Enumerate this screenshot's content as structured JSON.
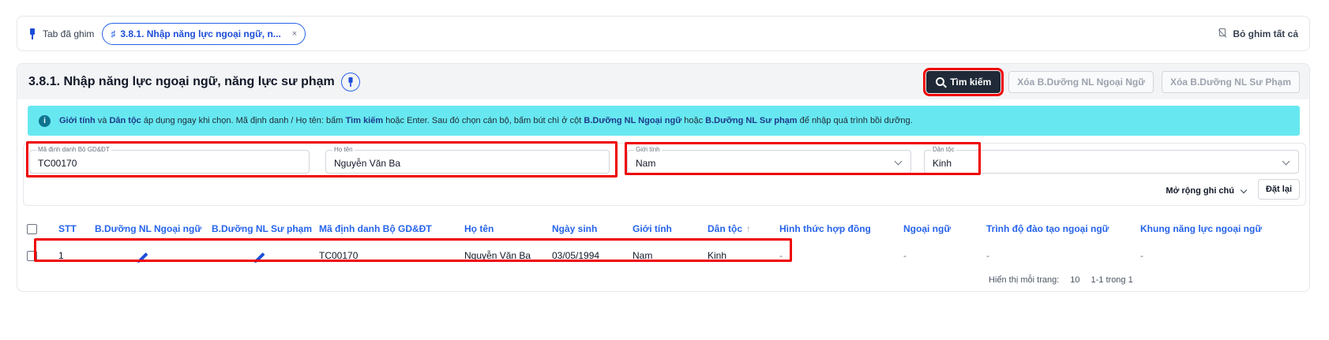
{
  "pin_bar": {
    "label": "Tab đã ghim",
    "pinned_tab": "3.8.1. Nhập năng lực ngoại ngữ, n...",
    "close_glyph": "×",
    "unpin_all": "Bỏ ghim tất cả"
  },
  "page": {
    "title": "3.8.1. Nhập năng lực ngoại ngữ, năng lực sư phạm",
    "actions": {
      "search": "Tìm kiếm",
      "delete_language": "Xóa B.Dưỡng NL Ngoại Ngữ",
      "delete_pedagogy": "Xóa B.Dưỡng NL Sư Phạm"
    }
  },
  "banner": {
    "bold1": "Giới tính",
    "t1": " và ",
    "bold2": "Dân tộc",
    "t2": " áp dụng ngay khi chọn. Mã định danh / Họ tên: bấm ",
    "bold3": "Tìm kiếm",
    "t3": " hoặc Enter. Sau đó chọn cán bộ, bấm bút chì ở cột ",
    "bold4": "B.Dưỡng NL Ngoại ngữ",
    "t4": " hoặc ",
    "bold5": "B.Dưỡng NL Sư phạm",
    "t5": " để nhập quá trình bồi dưỡng."
  },
  "filters": {
    "id": {
      "label": "Mã định danh Bộ GD&ĐT",
      "value": "TC00170"
    },
    "name": {
      "label": "Họ tên",
      "value": "Nguyễn Văn Ba"
    },
    "gender": {
      "label": "Giới tính",
      "value": "Nam"
    },
    "ethnicity": {
      "label": "Dân tộc",
      "value": "Kinh"
    },
    "note_toggle": "Mở rộng ghi chú",
    "reset": "Đặt lại"
  },
  "table": {
    "columns": {
      "stt": "STT",
      "lang_training": "B.Dưỡng NL Ngoại ngữ",
      "ped_training": "B.Dưỡng NL Sư phạm",
      "id": "Mã định danh Bộ GD&ĐT",
      "name": "Họ tên",
      "dob": "Ngày sinh",
      "gender": "Giới tính",
      "ethnicity": "Dân tộc",
      "contract": "Hình thức hợp đồng",
      "language": "Ngoại ngữ",
      "lang_level": "Trình độ đào tạo ngoại ngữ",
      "lang_framework": "Khung năng lực ngoại ngữ"
    },
    "sort_glyph": "↑",
    "rows": [
      {
        "stt": "1",
        "id": "TC00170",
        "name": "Nguyễn Văn Ba",
        "dob": "03/05/1994",
        "gender": "Nam",
        "ethnicity": "Kinh",
        "contract": "-",
        "language": "-",
        "lang_level": "-",
        "lang_framework": "-"
      }
    ]
  },
  "pagination": {
    "per_page_label": "Hiển thị mỗi trang:",
    "per_page": "10",
    "range": "1-1 trong 1"
  },
  "colors": {
    "primary": "#2563eb",
    "banner": "#67e8f0",
    "highlight": "#ef0000",
    "dark_button": "#1f2937"
  }
}
